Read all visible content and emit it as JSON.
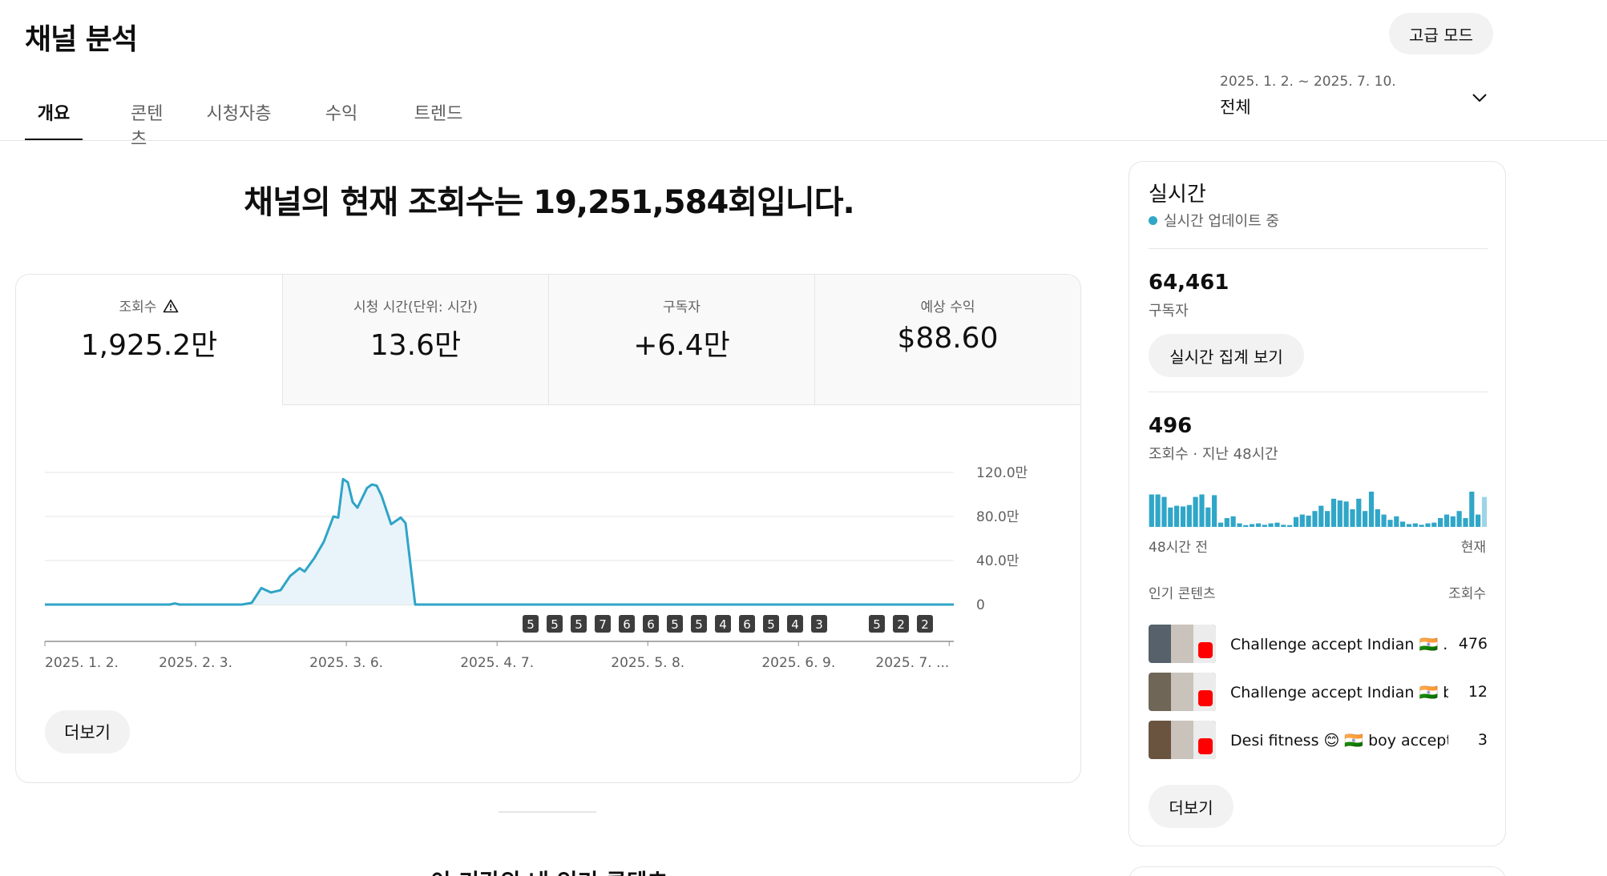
{
  "header": {
    "title": "채널 분석",
    "advanced_mode_label": "고급 모드"
  },
  "tabs": [
    {
      "label": "개요",
      "active": true
    },
    {
      "label": "콘텐츠",
      "active": false
    },
    {
      "label": "시청자층",
      "active": false
    },
    {
      "label": "수익",
      "active": false
    },
    {
      "label": "트렌드",
      "active": false
    }
  ],
  "date_range": {
    "range": "2025. 1. 2. ~ 2025. 7. 10.",
    "value": "전체",
    "icon": "chevron-down-icon"
  },
  "headline": "채널의 현재 조회수는 19,251,584회입니다.",
  "metrics": [
    {
      "label": "조회수",
      "value": "1,925.2만",
      "icon": "warning-icon",
      "active": true
    },
    {
      "label": "시청 시간(단위: 시간)",
      "value": "13.6만",
      "active": false
    },
    {
      "label": "구독자",
      "value": "+6.4만",
      "active": false
    },
    {
      "label": "예상 수익",
      "value": "$88.60",
      "active": false
    }
  ],
  "chart_data": {
    "type": "area",
    "x_tick_labels": [
      "2025. 1. 2.",
      "2025. 2. 3.",
      "2025. 3. 6.",
      "2025. 4. 7.",
      "2025. 5. 8.",
      "2025. 6. 9.",
      "2025. 7. ..."
    ],
    "y_tick_labels": [
      "120.0만",
      "80.0만",
      "40.0만",
      "0"
    ],
    "ylim": [
      0,
      1200000
    ],
    "x_range": [
      "2025-01-02",
      "2025-07-10"
    ],
    "series": [
      {
        "color": "#2fa4c7",
        "fill": "#e8f4fa",
        "points": [
          [
            "2025-01-02",
            0
          ],
          [
            "2025-01-28",
            0
          ],
          [
            "2025-01-29",
            10000
          ],
          [
            "2025-01-30",
            0
          ],
          [
            "2025-02-12",
            0
          ],
          [
            "2025-02-14",
            15000
          ],
          [
            "2025-02-16",
            150000
          ],
          [
            "2025-02-18",
            110000
          ],
          [
            "2025-02-20",
            130000
          ],
          [
            "2025-02-22",
            260000
          ],
          [
            "2025-02-24",
            330000
          ],
          [
            "2025-02-25",
            300000
          ],
          [
            "2025-02-27",
            420000
          ],
          [
            "2025-03-01",
            570000
          ],
          [
            "2025-03-03",
            800000
          ],
          [
            "2025-03-04",
            790000
          ],
          [
            "2025-03-05",
            1140000
          ],
          [
            "2025-03-06",
            1110000
          ],
          [
            "2025-03-07",
            930000
          ],
          [
            "2025-03-08",
            880000
          ],
          [
            "2025-03-10",
            1060000
          ],
          [
            "2025-03-11",
            1090000
          ],
          [
            "2025-03-12",
            1080000
          ],
          [
            "2025-03-13",
            990000
          ],
          [
            "2025-03-15",
            730000
          ],
          [
            "2025-03-16",
            760000
          ],
          [
            "2025-03-17",
            790000
          ],
          [
            "2025-03-18",
            740000
          ],
          [
            "2025-03-20",
            0
          ],
          [
            "2025-07-10",
            0
          ]
        ]
      }
    ],
    "markers": [
      {
        "date": "2025-04-13",
        "label": "5"
      },
      {
        "date": "2025-04-18",
        "label": "5"
      },
      {
        "date": "2025-04-23",
        "label": "5"
      },
      {
        "date": "2025-04-28",
        "label": "7"
      },
      {
        "date": "2025-05-03",
        "label": "6"
      },
      {
        "date": "2025-05-08",
        "label": "6"
      },
      {
        "date": "2025-05-13",
        "label": "5"
      },
      {
        "date": "2025-05-18",
        "label": "5"
      },
      {
        "date": "2025-05-23",
        "label": "4"
      },
      {
        "date": "2025-05-28",
        "label": "6"
      },
      {
        "date": "2025-06-02",
        "label": "5"
      },
      {
        "date": "2025-06-07",
        "label": "4"
      },
      {
        "date": "2025-06-12",
        "label": "3"
      },
      {
        "date": "2025-06-24",
        "label": "5"
      },
      {
        "date": "2025-06-29",
        "label": "2"
      },
      {
        "date": "2025-07-04",
        "label": "2"
      }
    ],
    "grid": true
  },
  "chart_more_label": "더보기",
  "next_section_title": "이 기간의 내 인기 콘텐츠",
  "realtime": {
    "title": "실시간",
    "status": "실시간 업데이트 중",
    "subscribers_value": "64,461",
    "subscribers_label": "구독자",
    "realtime_button": "실시간 집계 보기",
    "views_value": "496",
    "views_label": "조회수 · 지난 48시간",
    "hourly_views": [
      0.92,
      0.92,
      0.85,
      0.55,
      0.6,
      0.58,
      0.62,
      0.85,
      0.92,
      0.55,
      0.9,
      0.12,
      0.25,
      0.3,
      0.1,
      0.05,
      0.08,
      0.1,
      0.06,
      0.1,
      0.12,
      0.06,
      0.05,
      0.28,
      0.35,
      0.32,
      0.45,
      0.6,
      0.45,
      0.8,
      0.75,
      0.72,
      0.5,
      0.8,
      0.45,
      1.0,
      0.5,
      0.35,
      0.2,
      0.3,
      0.15,
      0.08,
      0.1,
      0.06,
      0.1,
      0.12,
      0.25,
      0.35,
      0.3,
      0.45,
      0.25,
      1.0,
      0.35,
      0.85
    ],
    "sparkline_start": "48시간 전",
    "sparkline_end": "현재",
    "popular_header": "인기 콘텐츠",
    "popular_views_header": "조회수",
    "popular": [
      {
        "title": "Challenge accept Indian 🇮🇳 ...",
        "views": "476",
        "thumb_color": "#56616c"
      },
      {
        "title": "Challenge accept Indian 🇮🇳 b...",
        "views": "12",
        "thumb_color": "#6f6658"
      },
      {
        "title": "Desi fitness 😊 🇮🇳 boy accept ...",
        "views": "3",
        "thumb_color": "#6a5440"
      }
    ],
    "more_label": "더보기"
  }
}
